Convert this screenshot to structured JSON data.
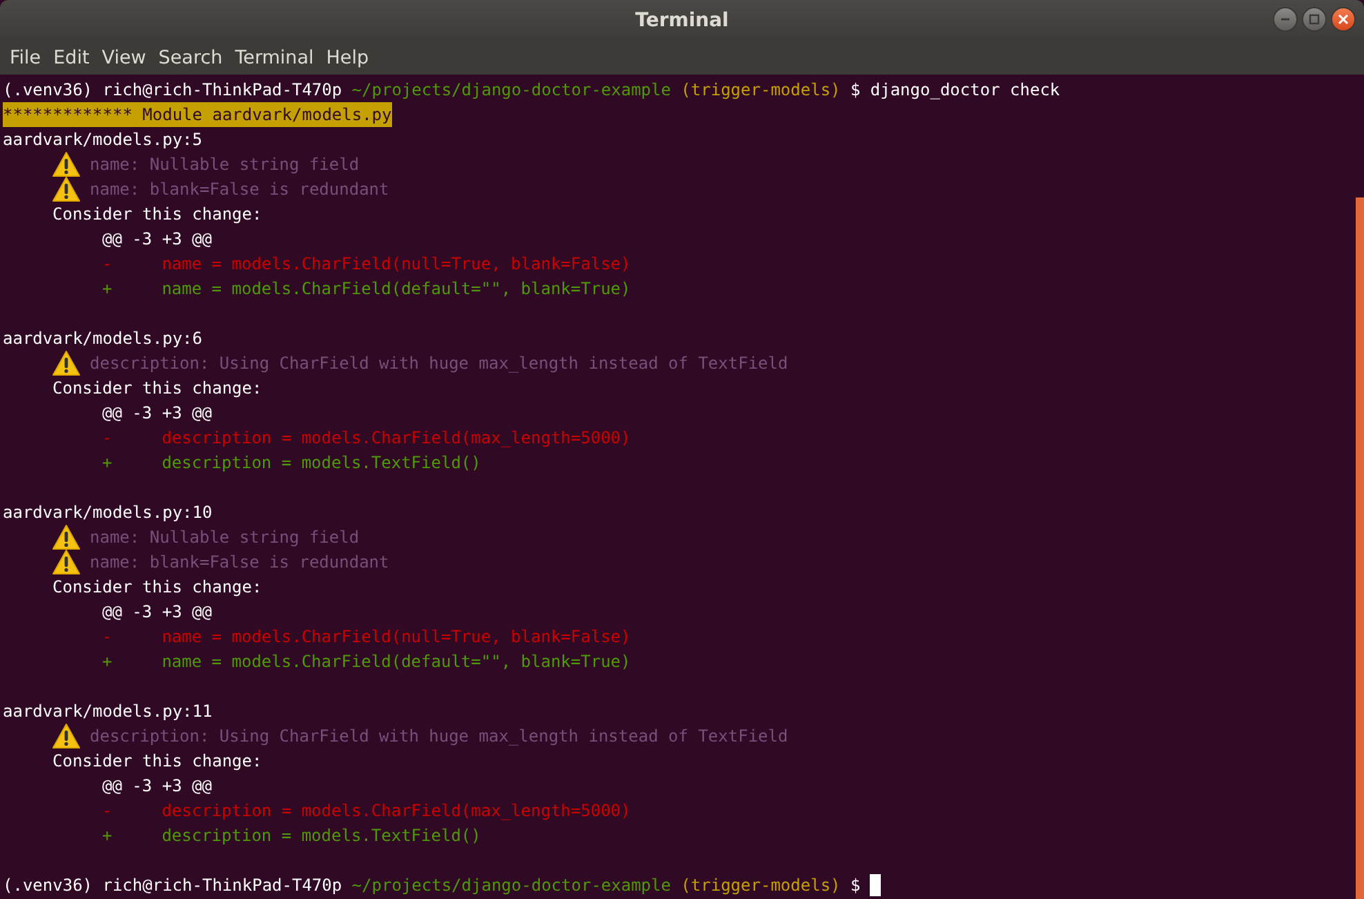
{
  "window": {
    "title": "Terminal"
  },
  "menu": [
    "File",
    "Edit",
    "View",
    "Search",
    "Terminal",
    "Help"
  ],
  "terminal": {
    "lines": [
      {
        "kind": "prompt",
        "venv": "(.venv36)",
        "user": "rich@rich-ThinkPad-T470p",
        "path": "~/projects/django-doctor-example",
        "branch": "(trigger-models)",
        "symbol": "$",
        "command": "django_doctor check",
        "cursor": false
      },
      {
        "kind": "banner",
        "text": "************* Module aardvark/models.py"
      },
      {
        "kind": "location",
        "text": "aardvark/models.py:5"
      },
      {
        "kind": "warning",
        "text": "name: Nullable string field"
      },
      {
        "kind": "warning",
        "text": "name: blank=False is redundant"
      },
      {
        "kind": "consider",
        "text": "Consider this change:"
      },
      {
        "kind": "hunk",
        "text": "@@ -3 +3 @@"
      },
      {
        "kind": "removed",
        "marker": "-",
        "code": "name = models.CharField(null=True, blank=False)"
      },
      {
        "kind": "added",
        "marker": "+",
        "code": "name = models.CharField(default=\"\", blank=True)"
      },
      {
        "kind": "blank"
      },
      {
        "kind": "location",
        "text": "aardvark/models.py:6"
      },
      {
        "kind": "warning",
        "text": "description: Using CharField with huge max_length instead of TextField"
      },
      {
        "kind": "consider",
        "text": "Consider this change:"
      },
      {
        "kind": "hunk",
        "text": "@@ -3 +3 @@"
      },
      {
        "kind": "removed",
        "marker": "-",
        "code": "description = models.CharField(max_length=5000)"
      },
      {
        "kind": "added",
        "marker": "+",
        "code": "description = models.TextField()"
      },
      {
        "kind": "blank"
      },
      {
        "kind": "location",
        "text": "aardvark/models.py:10"
      },
      {
        "kind": "warning",
        "text": "name: Nullable string field"
      },
      {
        "kind": "warning",
        "text": "name: blank=False is redundant"
      },
      {
        "kind": "consider",
        "text": "Consider this change:"
      },
      {
        "kind": "hunk",
        "text": "@@ -3 +3 @@"
      },
      {
        "kind": "removed",
        "marker": "-",
        "code": "name = models.CharField(null=True, blank=False)"
      },
      {
        "kind": "added",
        "marker": "+",
        "code": "name = models.CharField(default=\"\", blank=True)"
      },
      {
        "kind": "blank"
      },
      {
        "kind": "location",
        "text": "aardvark/models.py:11"
      },
      {
        "kind": "warning",
        "text": "description: Using CharField with huge max_length instead of TextField"
      },
      {
        "kind": "consider",
        "text": "Consider this change:"
      },
      {
        "kind": "hunk",
        "text": "@@ -3 +3 @@"
      },
      {
        "kind": "removed",
        "marker": "-",
        "code": "description = models.CharField(max_length=5000)"
      },
      {
        "kind": "added",
        "marker": "+",
        "code": "description = models.TextField()"
      },
      {
        "kind": "blank"
      },
      {
        "kind": "prompt",
        "venv": "(.venv36)",
        "user": "rich@rich-ThinkPad-T470p",
        "path": "~/projects/django-doctor-example",
        "branch": "(trigger-models)",
        "symbol": "$",
        "cursor": true
      }
    ]
  }
}
